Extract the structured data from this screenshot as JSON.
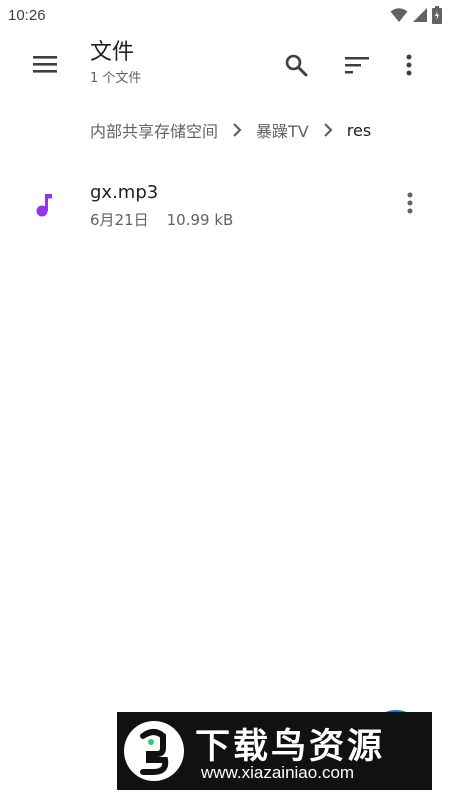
{
  "status_bar": {
    "time": "10:26",
    "icons": [
      "wifi-icon",
      "signal-icon",
      "battery-icon"
    ]
  },
  "app_bar": {
    "title": "文件",
    "subtitle": "1 个文件",
    "actions": [
      "search-icon",
      "sort-icon",
      "more-vert-icon"
    ]
  },
  "breadcrumb": {
    "items": [
      {
        "label": "内部共享存储空间"
      },
      {
        "label": "暴躁TV"
      },
      {
        "label": "res"
      }
    ]
  },
  "files": [
    {
      "name": "gx.mp3",
      "date": "6月21日",
      "size": "10.99 kB",
      "icon": "music-note-icon"
    }
  ],
  "watermark": {
    "title": "下载鸟资源",
    "url": "www.xiazainiao.com"
  },
  "colors": {
    "music_icon": "#9334e6",
    "fab": "#1a73e8",
    "watermark_bg": "#111111"
  }
}
